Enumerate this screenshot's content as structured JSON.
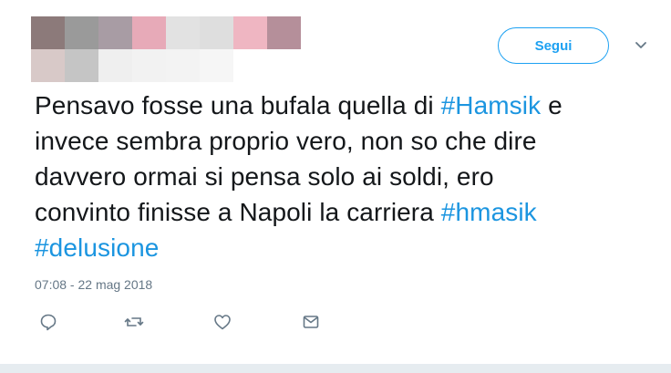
{
  "header": {
    "follow_label": "Segui",
    "redacted_colors": [
      "#8c7a7a",
      "#9a9a9a",
      "#a89ca4",
      "#e7aab8",
      "#e2e2e2",
      "#dedede",
      "#efb6c2",
      "#b58f9a",
      "#d8c9c8",
      "#c5c5c5",
      "#efefef",
      "#f2f2f2",
      "#f3f3f3",
      "#f6f6f6",
      "#ffffff",
      "#ffffff"
    ]
  },
  "tweet": {
    "line1_a": "Pensavo fosse una bufala quella di ",
    "line1_tag": "#Hamsik",
    "line1_b": " e",
    "line2": "invece sembra proprio vero, non so che dire",
    "line3": "davvero ormai si pensa solo ai soldi, ero",
    "line4_a": "convinto finisse a Napoli la carriera ",
    "line4_tag": "#hmasik",
    "line5_tag": "#delusione",
    "timestamp": "07:08 - 22 mag 2018"
  },
  "actions": {
    "icons": [
      "reply-icon",
      "retweet-icon",
      "like-icon",
      "message-icon"
    ]
  },
  "colors": {
    "accent": "#1da1f2",
    "hashtag": "#1b95e0",
    "text": "#14171a",
    "muted": "#657786"
  }
}
